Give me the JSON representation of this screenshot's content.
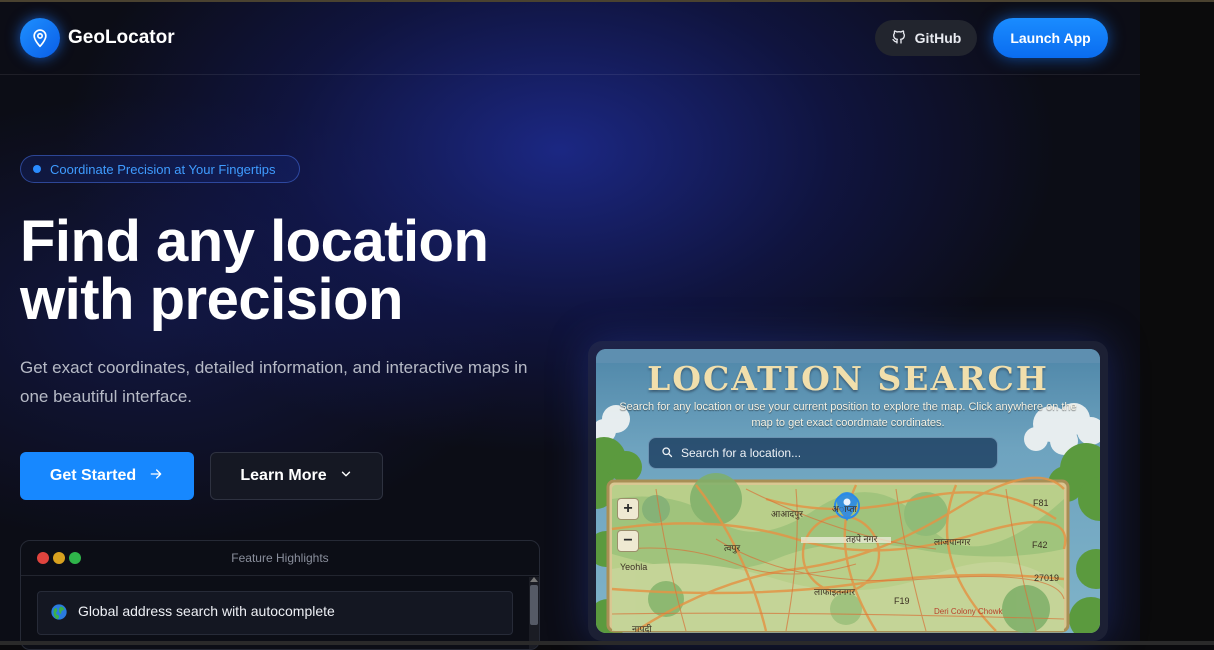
{
  "header": {
    "brand": "GeoLocator",
    "github_label": "GitHub",
    "launch_label": "Launch App"
  },
  "hero": {
    "badge": "Coordinate Precision at Your Fingertips",
    "headline_line1": "Find any location",
    "headline_line2": "with precision",
    "subtitle": "Get exact coordinates, detailed information, and interactive maps in one beautiful interface.",
    "primary_cta": "Get Started",
    "secondary_cta": "Learn More"
  },
  "features_panel": {
    "title": "Feature Highlights",
    "items": [
      {
        "icon": "globe-icon",
        "label": "Global address search with autocomplete"
      }
    ]
  },
  "preview": {
    "title": "LOCATION SEARCH",
    "description": "Search for any location or use your current position to explore the map. Click anywhere on the map to get exact coordmate cordinates.",
    "search_placeholder": "Search for a location...",
    "zoom_in": "+",
    "zoom_out": "−",
    "map_labels": [
      "आआदपुर",
      "अाप्ता",
      "तहपे नगर",
      "लाजपानगर",
      "त्वपुर",
      "F81",
      "F42",
      "27019",
      "F19",
      "Yeohla",
      "लाफाइतनगर",
      "Deri Colony Chowk",
      "नापदी"
    ]
  },
  "colors": {
    "accent": "#1788ff",
    "background": "#0c0d16"
  }
}
